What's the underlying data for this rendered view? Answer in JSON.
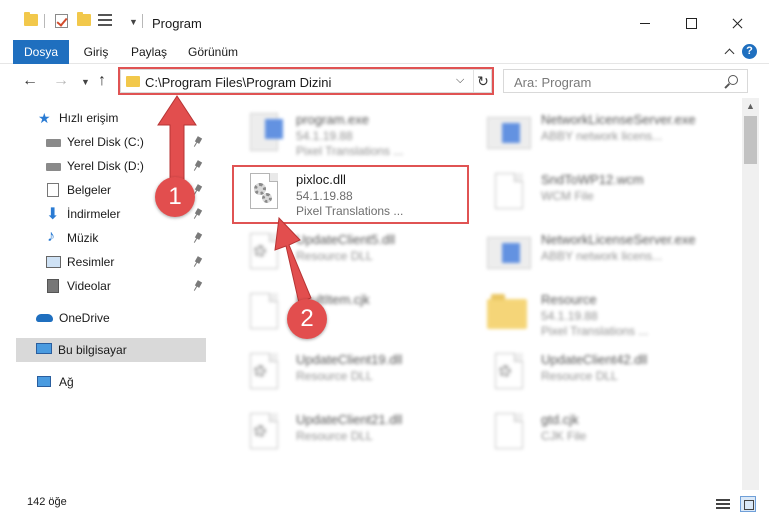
{
  "window": {
    "title": "Program",
    "controls": {
      "minimize": "minimize",
      "maximize": "maximize",
      "close": "close"
    }
  },
  "ribbon": {
    "tabs": [
      {
        "label": "Dosya"
      },
      {
        "label": "Giriş"
      },
      {
        "label": "Paylaş"
      },
      {
        "label": "Görünüm"
      }
    ],
    "help": "?"
  },
  "address_bar": {
    "path": "C:\\Program Files\\Program Dizini",
    "refresh_glyph": "↻",
    "dropdown_glyph": "⌵"
  },
  "search": {
    "placeholder": "Ara: Program"
  },
  "nav": {
    "quick_access": "Hızlı erişim",
    "items": [
      {
        "label": "Yerel Disk (C:)",
        "icon": "drive-icon"
      },
      {
        "label": "Yerel Disk (D:)",
        "icon": "drive-icon"
      },
      {
        "label": "Belgeler",
        "icon": "documents-icon"
      },
      {
        "label": "İndirmeler",
        "icon": "downloads-icon"
      },
      {
        "label": "Müzik",
        "icon": "music-icon"
      },
      {
        "label": "Resimler",
        "icon": "pictures-icon"
      },
      {
        "label": "Videolar",
        "icon": "videos-icon"
      }
    ],
    "onedrive": "OneDrive",
    "this_pc": "Bu bilgisayar",
    "network": "Ağ"
  },
  "files": {
    "left": [
      {
        "name": "program.exe",
        "line2": "54.1.19.88",
        "line3": "Pixel Translations ...",
        "icon": "app-icon"
      },
      {
        "name": "pixloc.dll",
        "line2": "54.1.19.88",
        "line3": "Pixel Translations ...",
        "icon": "dll-gear-icon"
      },
      {
        "name": "UpdateClient5.dll",
        "line2": "Resource DLL",
        "line3": "",
        "icon": "dll-gear-icon"
      },
      {
        "name": "FaultItem.cjk",
        "line2": "",
        "line3": "",
        "icon": "file-icon"
      },
      {
        "name": "UpdateClient19.dll",
        "line2": "Resource DLL",
        "line3": "",
        "icon": "dll-gear-icon"
      },
      {
        "name": "UpdateClient21.dll",
        "line2": "Resource DLL",
        "line3": "",
        "icon": "dll-gear-icon"
      }
    ],
    "right": [
      {
        "name": "NetworkLicenseServer.exe",
        "line2": "ABBY network licens...",
        "line3": "",
        "icon": "app-icon"
      },
      {
        "name": "SndToWP12.wcm",
        "line2": "WCM File",
        "line3": "",
        "icon": "file-icon"
      },
      {
        "name": "NetworkLicenseServer.exe",
        "line2": "ABBY network licens...",
        "line3": "",
        "icon": "app-icon"
      },
      {
        "name": "Resource",
        "line2": "54.1.19.88",
        "line3": "Pixel Translations ...",
        "icon": "folder-icon"
      },
      {
        "name": "UpdateClient42.dll",
        "line2": "Resource DLL",
        "line3": "",
        "icon": "dll-gear-icon"
      },
      {
        "name": "gtd.cjk",
        "line2": "CJK File",
        "line3": "",
        "icon": "file-icon"
      }
    ]
  },
  "status": {
    "count": "142 öğe"
  },
  "callouts": [
    "1",
    "2"
  ],
  "colors": {
    "accent": "#1f6fbf",
    "highlight": "#e05353",
    "folder": "#f2c84b"
  }
}
